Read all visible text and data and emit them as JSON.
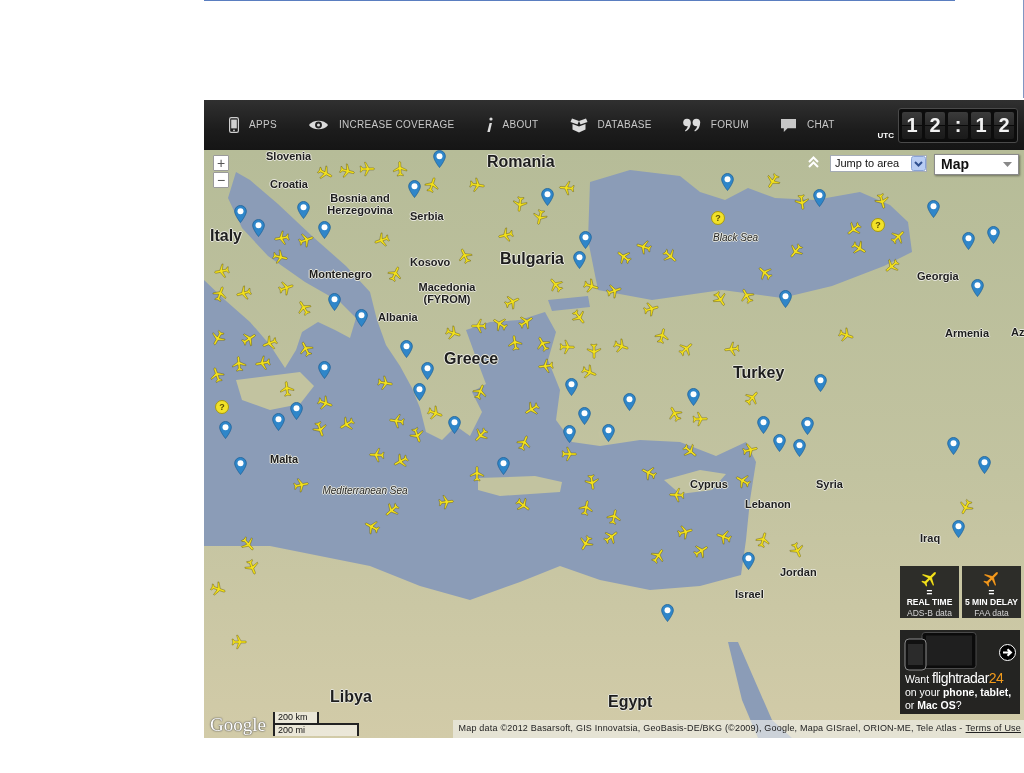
{
  "nav": {
    "links": [
      "APPS",
      "INCREASE COVERAGE",
      "ABOUT",
      "DATABASE",
      "FORUM",
      "CHAT"
    ]
  },
  "clock": {
    "zone": "UTC",
    "digits": [
      "1",
      "2",
      ":",
      "1",
      "2"
    ]
  },
  "map": {
    "zoom_controls": [
      "+",
      "−"
    ],
    "jump_select": {
      "value": "Jump to area"
    },
    "type_select": {
      "value": "Map"
    },
    "labels": [
      {
        "text": "Slovenia",
        "kind": "country"
      },
      {
        "text": "Romania",
        "kind": "major"
      },
      {
        "text": "Croatia",
        "kind": "country"
      },
      {
        "text": "Bosnia and Herzegovina",
        "kind": "country"
      },
      {
        "text": "Serbia",
        "kind": "country"
      },
      {
        "text": "Italy",
        "kind": "major"
      },
      {
        "text": "Black Sea",
        "kind": "sea"
      },
      {
        "text": "Bulgaria",
        "kind": "major"
      },
      {
        "text": "Kosovo",
        "kind": "country"
      },
      {
        "text": "Montenegro",
        "kind": "country"
      },
      {
        "text": "Georgia",
        "kind": "country"
      },
      {
        "text": "Macedonia (FYROM)",
        "kind": "country"
      },
      {
        "text": "Albania",
        "kind": "country"
      },
      {
        "text": "Armenia",
        "kind": "country"
      },
      {
        "text": "Az",
        "kind": "country"
      },
      {
        "text": "Greece",
        "kind": "major"
      },
      {
        "text": "Turkey",
        "kind": "major"
      },
      {
        "text": "Malta",
        "kind": "country"
      },
      {
        "text": "Cyprus",
        "kind": "country"
      },
      {
        "text": "Syria",
        "kind": "country"
      },
      {
        "text": "Mediterranean Sea",
        "kind": "sea"
      },
      {
        "text": "Lebanon",
        "kind": "country"
      },
      {
        "text": "Iraq",
        "kind": "country"
      },
      {
        "text": "Jordan",
        "kind": "country"
      },
      {
        "text": "Israel",
        "kind": "country"
      },
      {
        "text": "Libya",
        "kind": "major"
      },
      {
        "text": "Egypt",
        "kind": "major"
      }
    ],
    "help_markers": [
      "?",
      "?",
      "?"
    ]
  },
  "legend": [
    {
      "symbol": "=",
      "title": "REAL TIME",
      "subtitle": "ADS-B data",
      "color": "#f4e21c"
    },
    {
      "symbol": "=",
      "title": "5 MIN DELAY",
      "subtitle": "FAA data",
      "color": "#f59a1e"
    }
  ],
  "promo": {
    "lead": "Want",
    "brand": "flightradar",
    "brand_number": "24",
    "text": "on your **phone, tablet,** or **Mac OS**?"
  },
  "footer": {
    "logo": "Google",
    "scale": [
      "200 km",
      "200 mi"
    ],
    "attribution": "Map data ©2012 Basarsoft, GIS Innovatsia, GeoBasis-DE/BKG (©2009), Google, Mapa GISrael, ORION-ME, Tele Atlas -",
    "terms_link": "Terms of Use"
  }
}
